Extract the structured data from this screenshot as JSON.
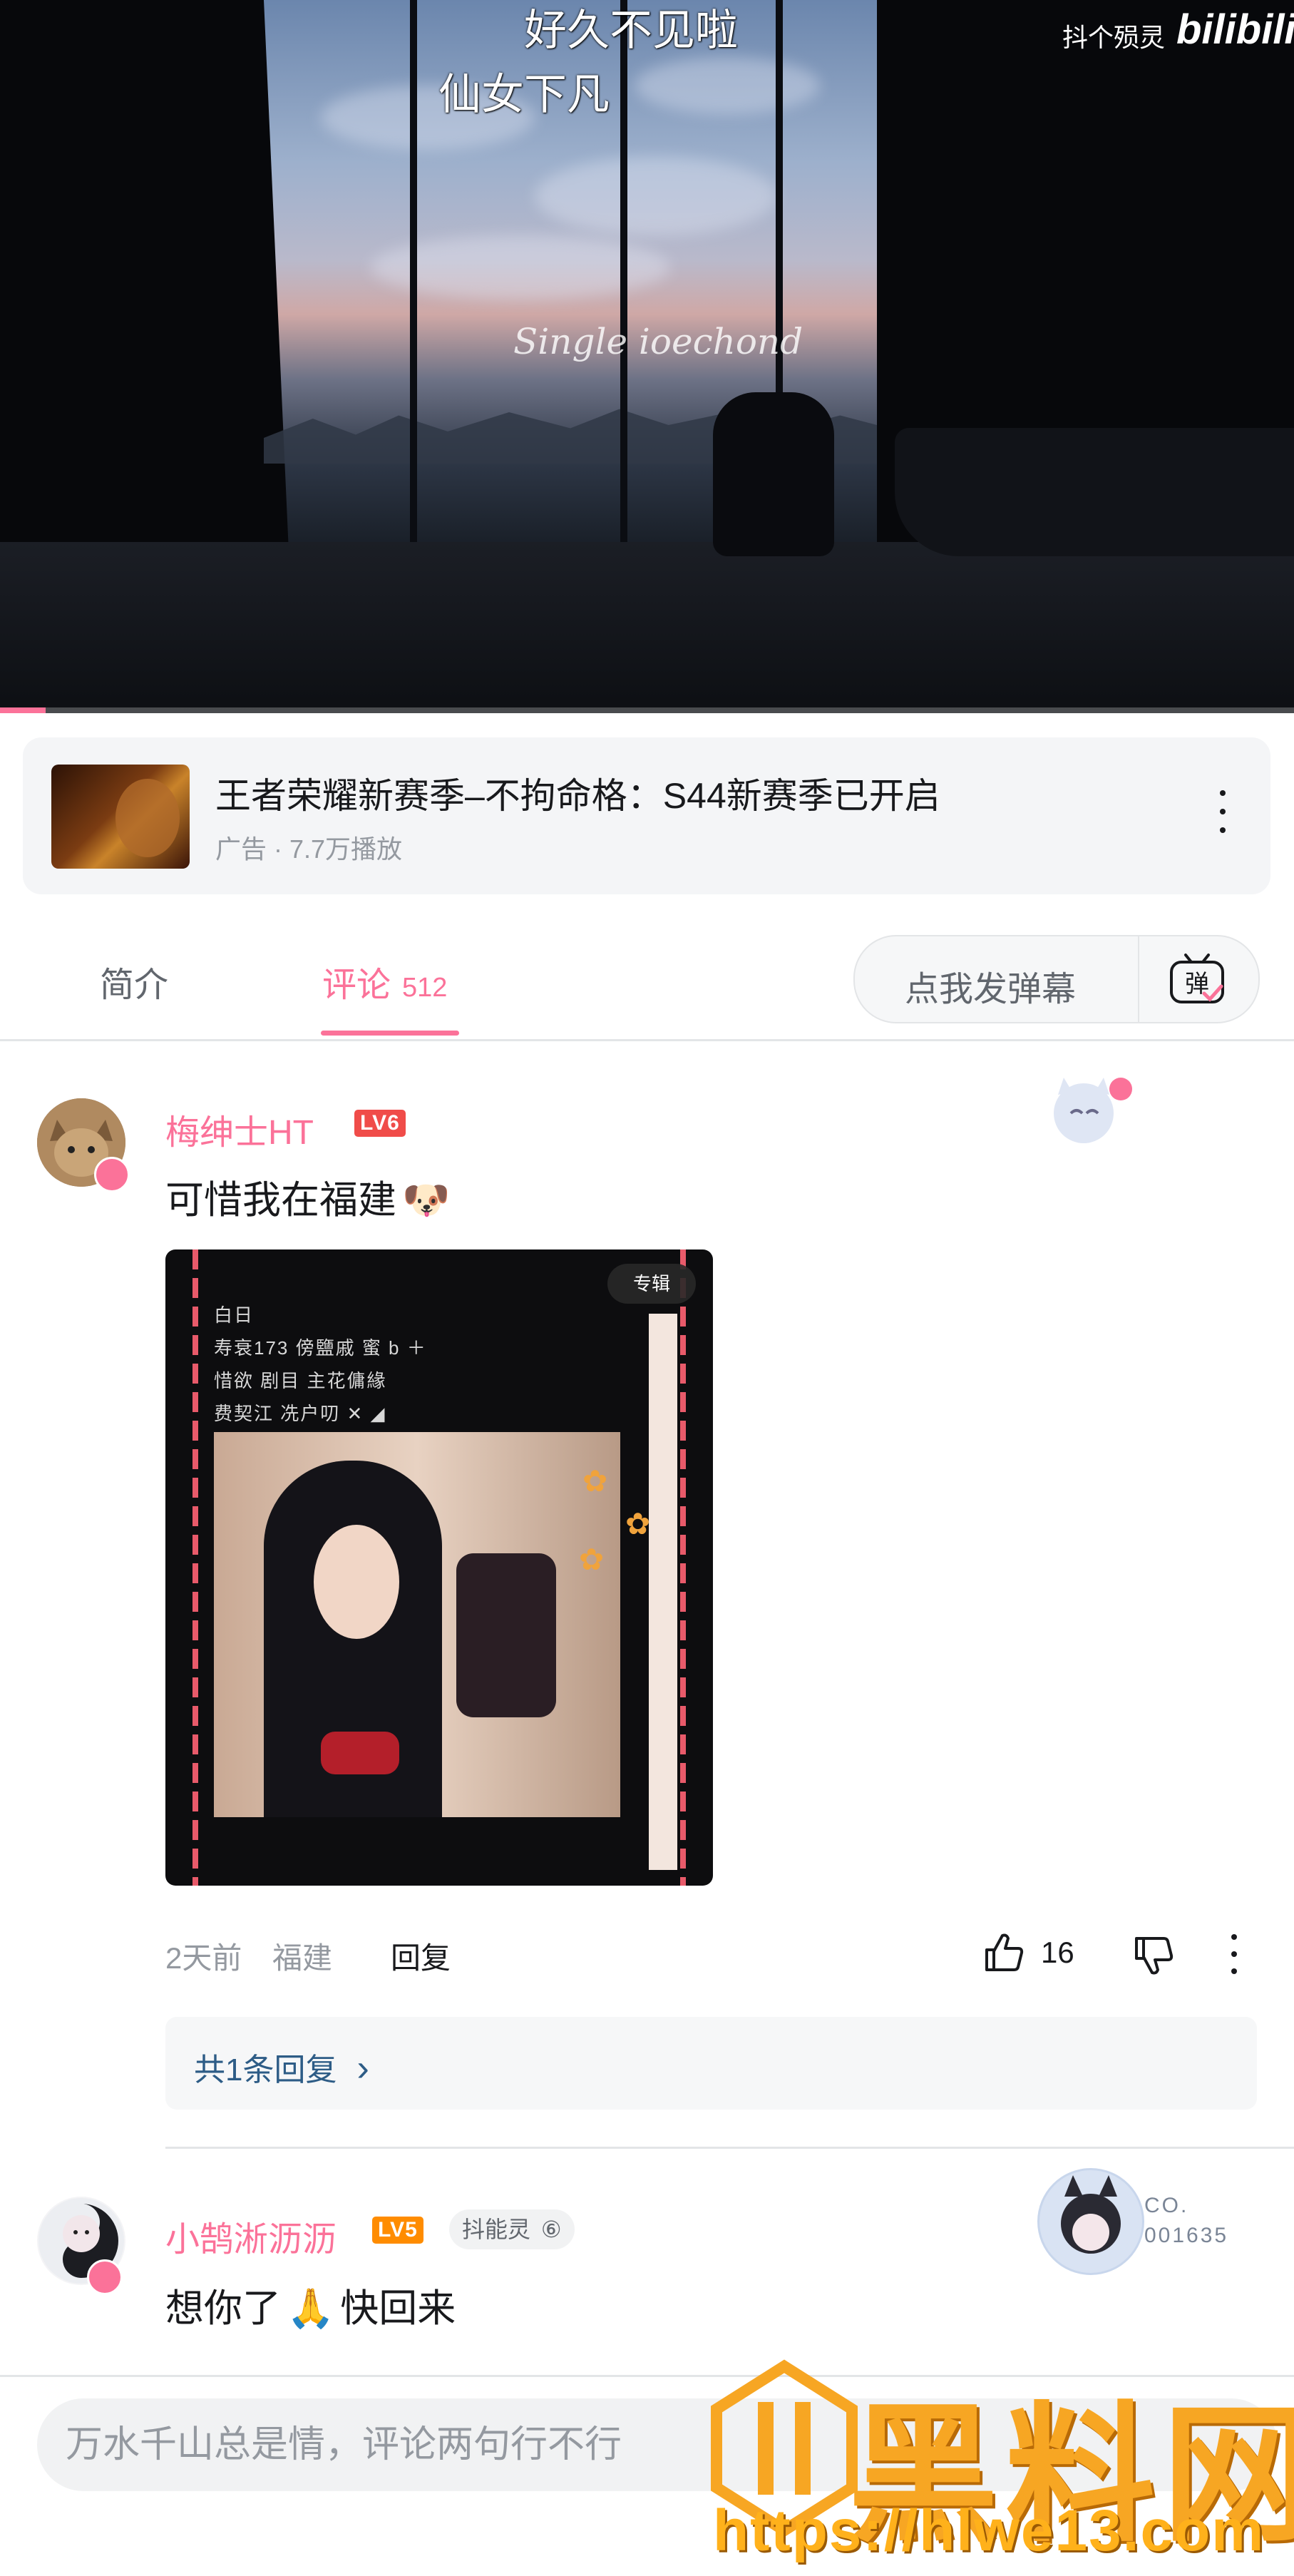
{
  "video": {
    "danmaku": [
      "好久不见啦",
      "仙女下凡"
    ],
    "signature_watermark": "Single ioechond",
    "brand_tag": "抖个殒灵",
    "logo_text": "bilibili",
    "progress_fraction": 0.035,
    "progress_color": "#fb7299"
  },
  "ad": {
    "title": "王者荣耀新赛季–不拘命格：S44新赛季已开启",
    "meta": "广告 · 7.7万播放",
    "more_icon": "more-vertical-icon"
  },
  "tabs": {
    "intro_label": "简介",
    "comments_label": "评论",
    "comments_count": "512",
    "danmaku_placeholder": "点我发弹幕",
    "danmaku_toggle_glyph": "弹",
    "accent_color": "#fb7299"
  },
  "comments": [
    {
      "username": "梅绅士HT",
      "level": "LV6",
      "level_color": "#f04c49",
      "text": "可惜我在福建",
      "emoji": "🐶",
      "image": {
        "tag": "专辑",
        "lines": [
          "白日",
          "寿衰173 傍鹽戚 蜜 b ＋",
          "惜欲 剧目 主花傭緣",
          "费契江 冼户叨 ✕ ◢"
        ]
      },
      "time": "2天前",
      "location": "福建",
      "reply_label": "回复",
      "likes": "16",
      "replies_summary": "共1条回复",
      "chevron": "›"
    },
    {
      "username": "小鹄淅沥沥",
      "level": "LV5",
      "level_color": "#ff8c00",
      "fan_tag": "抖能灵",
      "fan_tag_suffix": "⑥",
      "text_before": "想你了",
      "emoji": "🙏",
      "text_after": "快回来",
      "badge_text_top": "CO.",
      "badge_text_bottom": "001635"
    }
  ],
  "bottom_bar": {
    "comment_placeholder": "万水千山总是情，评论两句行不行"
  },
  "site_watermark": {
    "logo_text": "黑料网",
    "url": "https://hlwe13.com"
  }
}
